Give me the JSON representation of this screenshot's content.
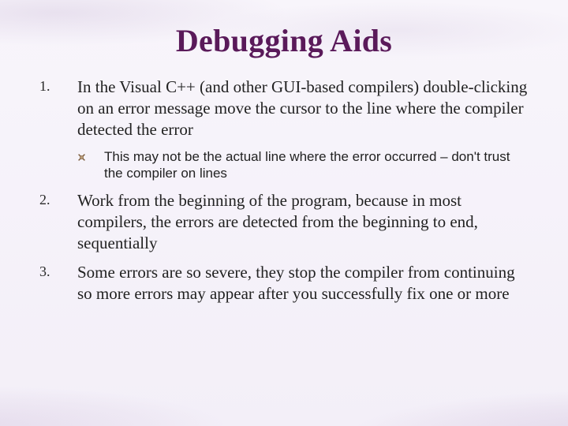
{
  "title": "Debugging Aids",
  "items": [
    {
      "num": "1.",
      "text": "In the Visual C++ (and other GUI-based compilers) double-clicking on an error message move the cursor to the line where the compiler detected the error",
      "sub": "This may not be the actual line where the error occurred – don't trust the compiler on lines"
    },
    {
      "num": "2.",
      "text": "Work from the beginning of the program, because in most compilers, the errors are detected from the beginning to end, sequentially"
    },
    {
      "num": "3.",
      "text": "Some errors are so severe, they stop the compiler from continuing so more errors may appear after you successfully fix one or more"
    }
  ]
}
